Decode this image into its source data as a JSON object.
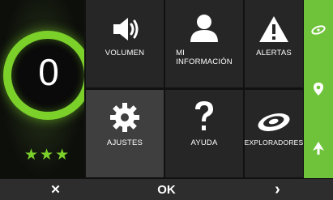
{
  "score": {
    "value": "0",
    "rating_stars": 3,
    "star_glyph": "★"
  },
  "tiles": [
    {
      "label": "VOLUMEN",
      "icon": "speaker-icon"
    },
    {
      "label": "MI\nINFORMACIÓN",
      "icon": "user-icon"
    },
    {
      "label": "ALERTAS",
      "icon": "alert-icon"
    },
    {
      "label": "AJUSTES",
      "icon": "gear-icon"
    },
    {
      "label": "AYUDA",
      "icon": "help-icon"
    },
    {
      "label": "EXPLORADORES",
      "icon": "radar-icon"
    }
  ],
  "sidebar": {
    "icons": [
      "radar-icon",
      "location-pin-icon",
      "navigation-arrow-icon"
    ]
  },
  "bottom_bar": {
    "close_label": "✕",
    "ok_label": "OK",
    "next_label": "›"
  },
  "colors": {
    "accent": "#7bd12a",
    "sidebar": "#6fc33a",
    "tile": "#262626",
    "tile_selected": "#3f3f3f"
  }
}
